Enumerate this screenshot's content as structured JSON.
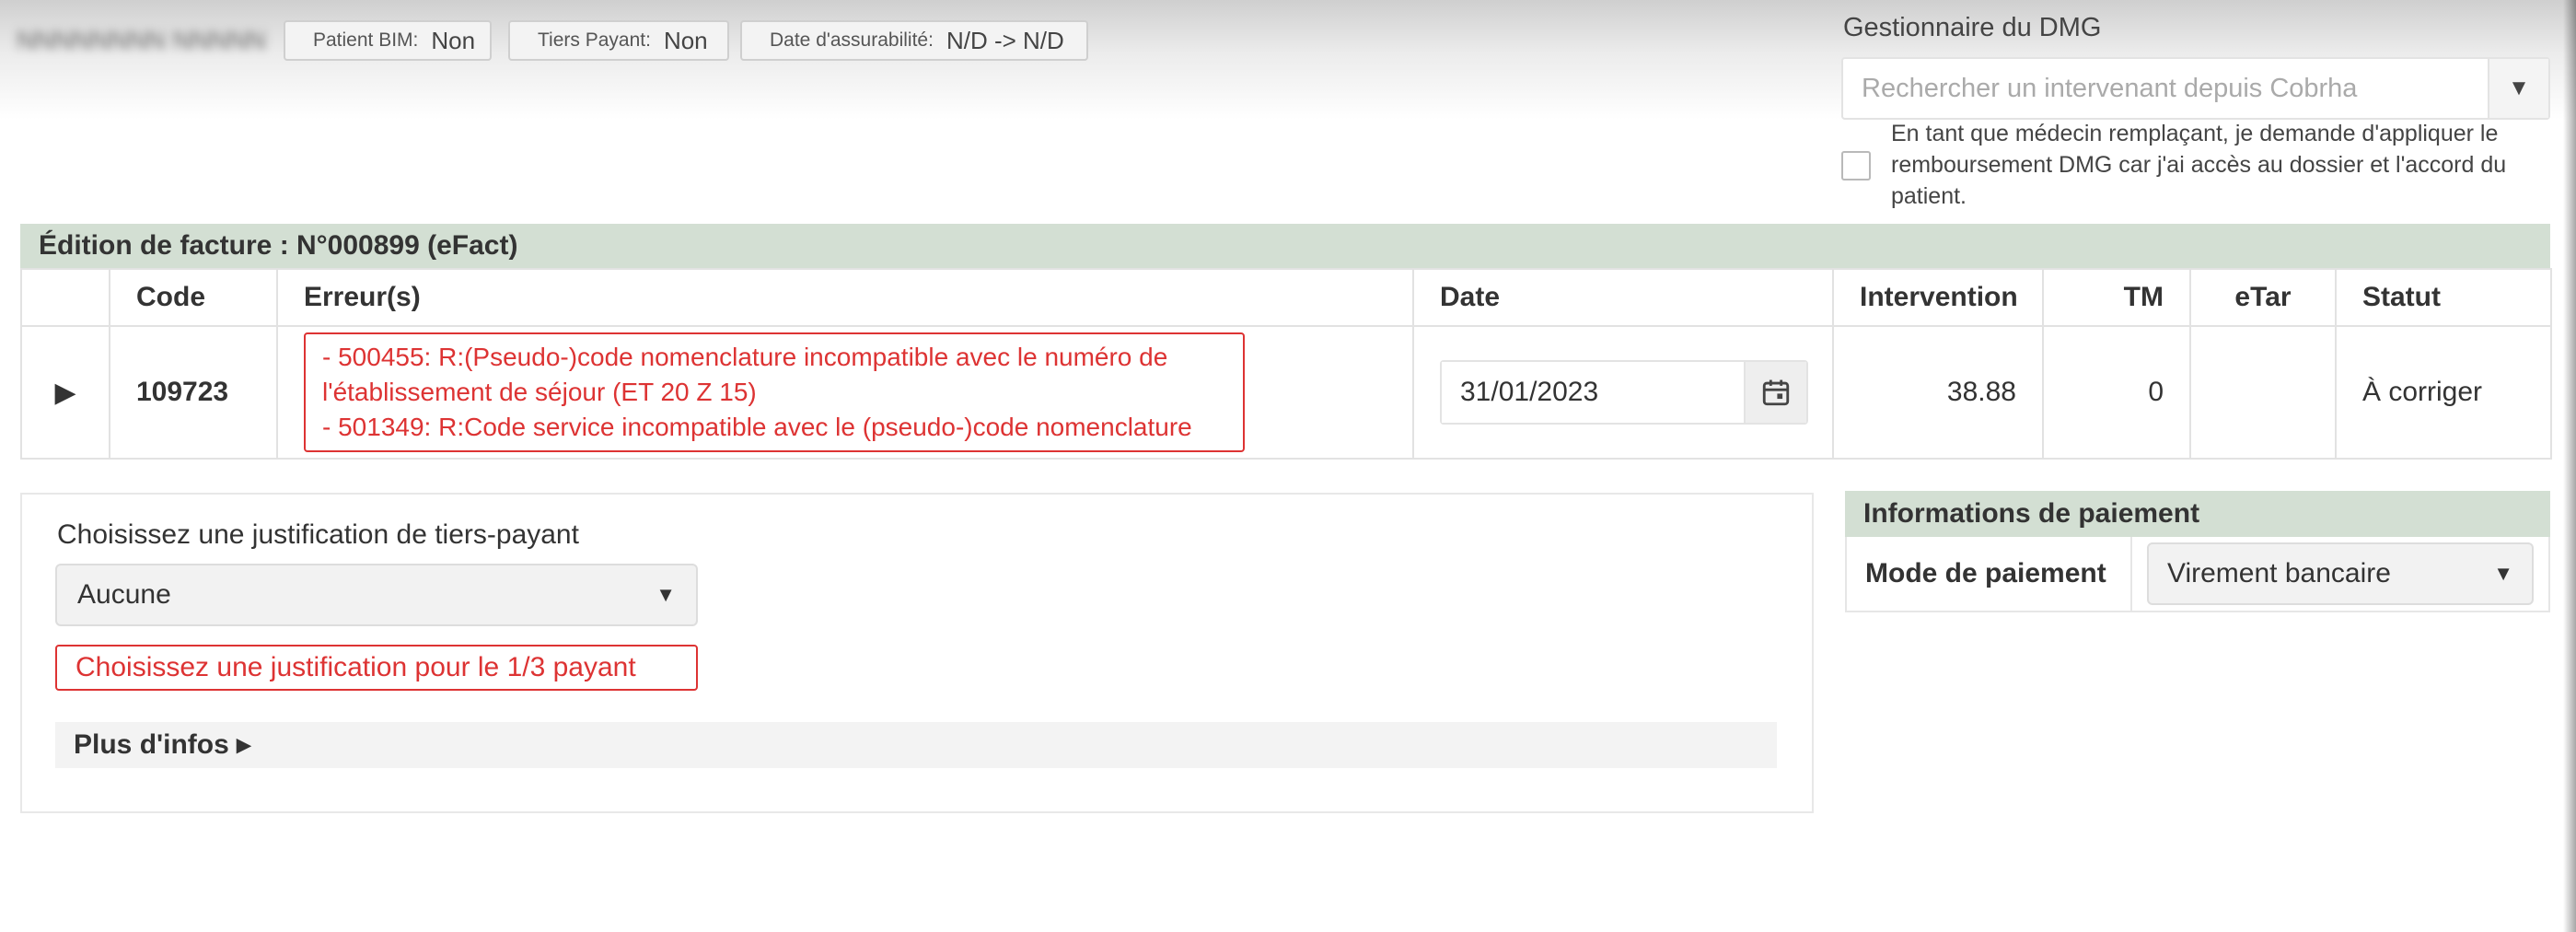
{
  "patient_bar": {
    "name": "NNNNNNNN NNNNN",
    "bim_label": "Patient BIM:",
    "bim_value": "Non",
    "tiers_label": "Tiers Payant:",
    "tiers_value": "Non",
    "assur_label": "Date d'assurabilité:",
    "assur_value": "N/D -> N/D"
  },
  "dmg": {
    "title": "Gestionnaire du DMG",
    "search_placeholder": "Rechercher un intervenant depuis Cobrha",
    "checkbox_text": "En tant que médecin remplaçant, je demande d'appliquer le remboursement DMG car j'ai accès au dossier et l'accord du patient.",
    "checked": false
  },
  "invoice": {
    "title": "Édition de facture : N°000899 (eFact)",
    "columns": [
      "",
      "Code",
      "Erreur(s)",
      "Date",
      "Intervention",
      "TM",
      "eTar",
      "Statut"
    ],
    "rows": [
      {
        "code": "109723",
        "errors": [
          "- 500455: R:(Pseudo-)code nomenclature incompatible avec le numéro de",
          "l'établissement de séjour (ET 20 Z 15)",
          "- 501349: R:Code service incompatible avec le (pseudo-)code nomenclature"
        ],
        "date": "31/01/2023",
        "intervention": "38.88",
        "tm": "0",
        "etar": "",
        "statut": "À corriger"
      }
    ]
  },
  "justification": {
    "label": "Choisissez une justification de tiers-payant",
    "selected": "Aucune",
    "warning": "Choisissez une justification pour le 1/3 payant",
    "more_info": "Plus d'infos ▸"
  },
  "payment": {
    "title": "Informations de paiement",
    "mode_label": "Mode de paiement",
    "mode_value": "Virement bancaire"
  },
  "colors": {
    "panel_header_bg": "#d3dfd3",
    "error_red": "#dd3333",
    "text": "#333333"
  },
  "icons": {
    "expander": "caret-right-icon",
    "dropdown": "caret-down-icon",
    "calendar": "calendar-icon"
  }
}
